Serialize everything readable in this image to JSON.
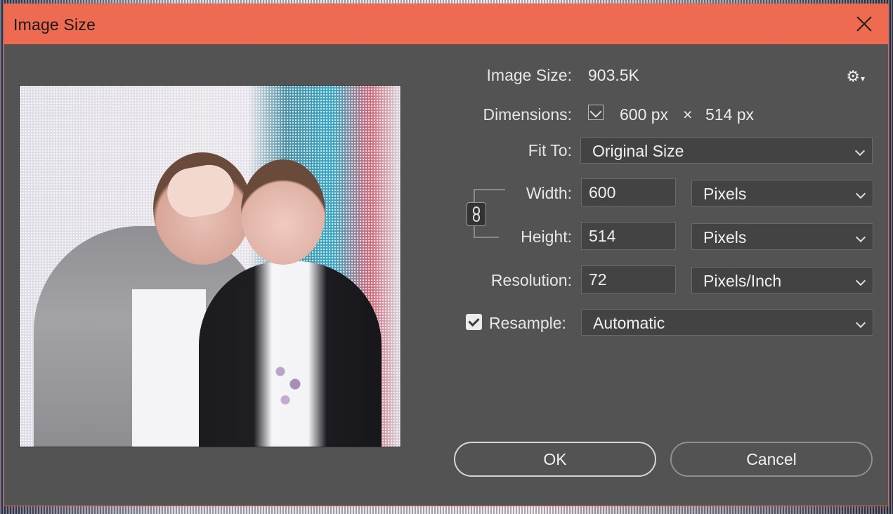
{
  "window": {
    "title": "Image Size"
  },
  "info": {
    "image_size_label": "Image Size:",
    "image_size_value": "903.5K",
    "dimensions_label": "Dimensions:",
    "dim_width": "600 px",
    "dim_times": "×",
    "dim_height": "514 px"
  },
  "fit_to": {
    "label": "Fit To:",
    "value": "Original Size"
  },
  "width": {
    "label": "Width:",
    "value": "600",
    "unit": "Pixels"
  },
  "height": {
    "label": "Height:",
    "value": "514",
    "unit": "Pixels"
  },
  "resolution": {
    "label": "Resolution:",
    "value": "72",
    "unit": "Pixels/Inch"
  },
  "resample": {
    "label": "Resample:",
    "checked": true,
    "value": "Automatic"
  },
  "buttons": {
    "ok": "OK",
    "cancel": "Cancel"
  },
  "icons": {
    "settings": "gear-icon",
    "close": "close-icon",
    "link": "chain-link-icon",
    "dropdown": "chevron-down-icon"
  },
  "colors": {
    "titlebar": "#ee6a50",
    "dialog_bg": "#535353",
    "field_bg": "#434343"
  }
}
